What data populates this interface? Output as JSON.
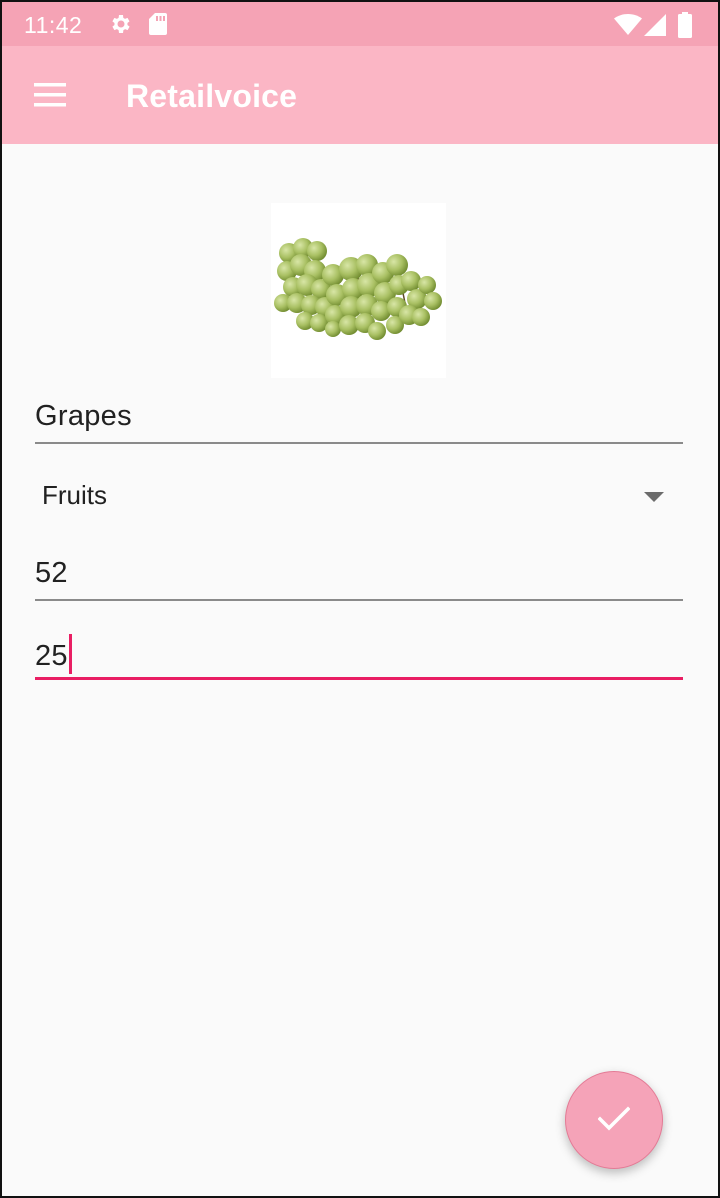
{
  "status_bar": {
    "time": "11:42",
    "icons": [
      "settings-icon",
      "sd-card-icon",
      "wifi-icon",
      "signal-icon",
      "battery-icon"
    ]
  },
  "app_bar": {
    "title": "Retailvoice",
    "nav_icon": "menu-icon"
  },
  "product": {
    "image": "grapes-photo",
    "name": "Grapes",
    "category": "Fruits",
    "field_3": "52",
    "field_4": "25"
  },
  "fab": {
    "icon": "check-icon"
  },
  "colors": {
    "status_bar": "#f5a3b5",
    "app_bar": "#fbb6c5",
    "accent": "#e91e63",
    "fab": "#f5a3b8",
    "background": "#fafafa"
  }
}
